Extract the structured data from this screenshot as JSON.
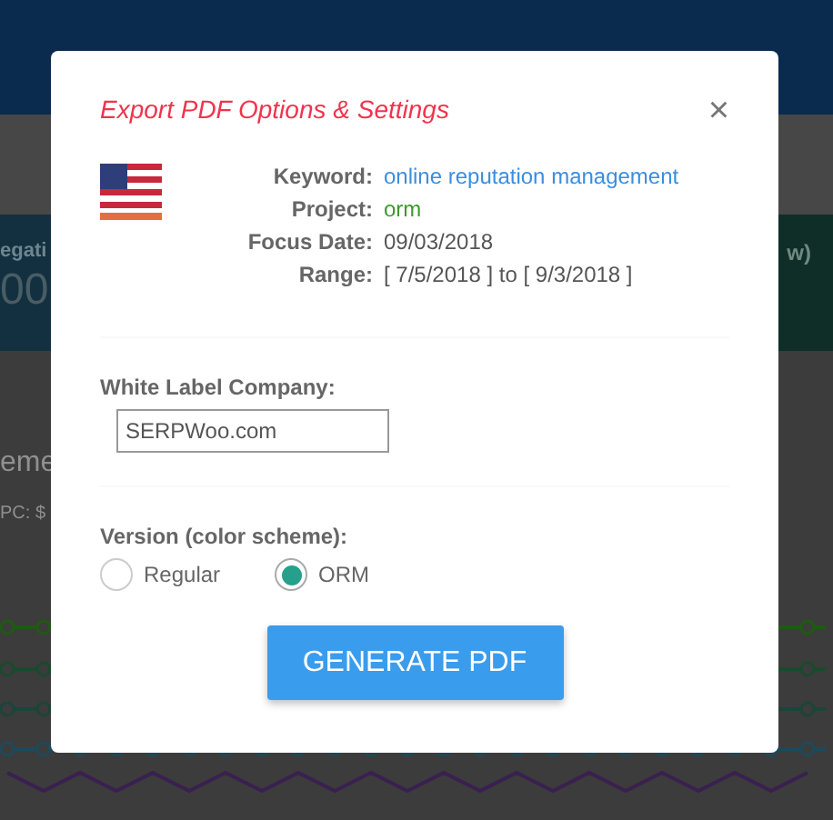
{
  "background": {
    "left_card": {
      "label": "egati",
      "value": "00"
    },
    "right_card": {
      "label": "w)"
    },
    "heading": "eme",
    "subtext": "PC: $"
  },
  "modal": {
    "title": "Export PDF Options & Settings",
    "close": "×",
    "details": [
      {
        "label": "Keyword:",
        "value": "online reputation management",
        "kind": "link"
      },
      {
        "label": "Project:",
        "value": "orm",
        "kind": "project"
      },
      {
        "label": "Focus Date:",
        "value": "09/03/2018",
        "kind": "plain"
      },
      {
        "label": "Range:",
        "value": "[ 7/5/2018 ] to [ 9/3/2018 ]",
        "kind": "plain"
      }
    ],
    "white_label": {
      "label": "White Label Company:",
      "value": "SERPWoo.com"
    },
    "version": {
      "label": "Version (color scheme):",
      "options": [
        {
          "label": "Regular",
          "selected": false
        },
        {
          "label": "ORM",
          "selected": true
        }
      ]
    },
    "button": "GENERATE PDF"
  }
}
